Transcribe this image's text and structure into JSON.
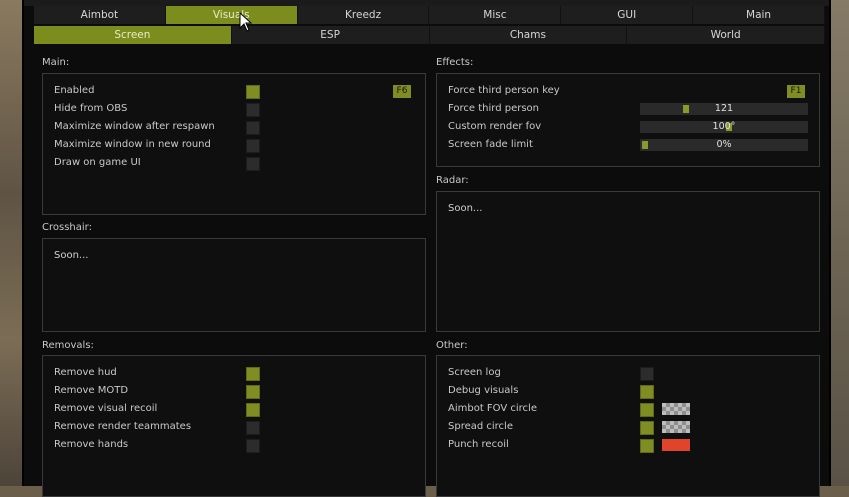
{
  "tabs": [
    "Aimbot",
    "Visuals",
    "Kreedz",
    "Misc",
    "GUI",
    "Main"
  ],
  "active_tab": "Visuals",
  "subtabs": [
    "Screen",
    "ESP",
    "Chams",
    "World"
  ],
  "active_subtab": "Screen",
  "main": {
    "title": "Main:",
    "rows": [
      {
        "label": "Enabled",
        "checked": true
      },
      {
        "label": "Hide from OBS",
        "checked": false
      },
      {
        "label": "Maximize window after respawn",
        "checked": false
      },
      {
        "label": "Maximize window in new round",
        "checked": false
      },
      {
        "label": "Draw on game UI",
        "checked": false
      }
    ],
    "hotkey": "F6"
  },
  "effects": {
    "title": "Effects:",
    "key_label": "Force third person key",
    "key": "F1",
    "sliders": [
      {
        "label": "Force third person",
        "value": "121",
        "fraction": 0.25
      },
      {
        "label": "Custom render fov",
        "value": "100°",
        "fraction": 0.52
      },
      {
        "label": "Screen fade limit",
        "value": "0%",
        "fraction": 0.0
      }
    ]
  },
  "crosshair": {
    "title": "Crosshair:",
    "text": "Soon..."
  },
  "radar": {
    "title": "Radar:",
    "text": "Soon..."
  },
  "removals": {
    "title": "Removals:",
    "rows": [
      {
        "label": "Remove hud",
        "checked": true
      },
      {
        "label": "Remove MOTD",
        "checked": true
      },
      {
        "label": "Remove visual recoil",
        "checked": true
      },
      {
        "label": "Remove render teammates",
        "checked": false
      },
      {
        "label": "Remove hands",
        "checked": false
      }
    ]
  },
  "other": {
    "title": "Other:",
    "rows": [
      {
        "label": "Screen log",
        "checked": false,
        "swatch": null
      },
      {
        "label": "Debug visuals",
        "checked": true,
        "swatch": null
      },
      {
        "label": "Aimbot FOV circle",
        "checked": true,
        "swatch": "transparent"
      },
      {
        "label": "Spread circle",
        "checked": true,
        "swatch": "transparent"
      },
      {
        "label": "Punch recoil",
        "checked": true,
        "swatch": "#e0452b"
      }
    ]
  }
}
